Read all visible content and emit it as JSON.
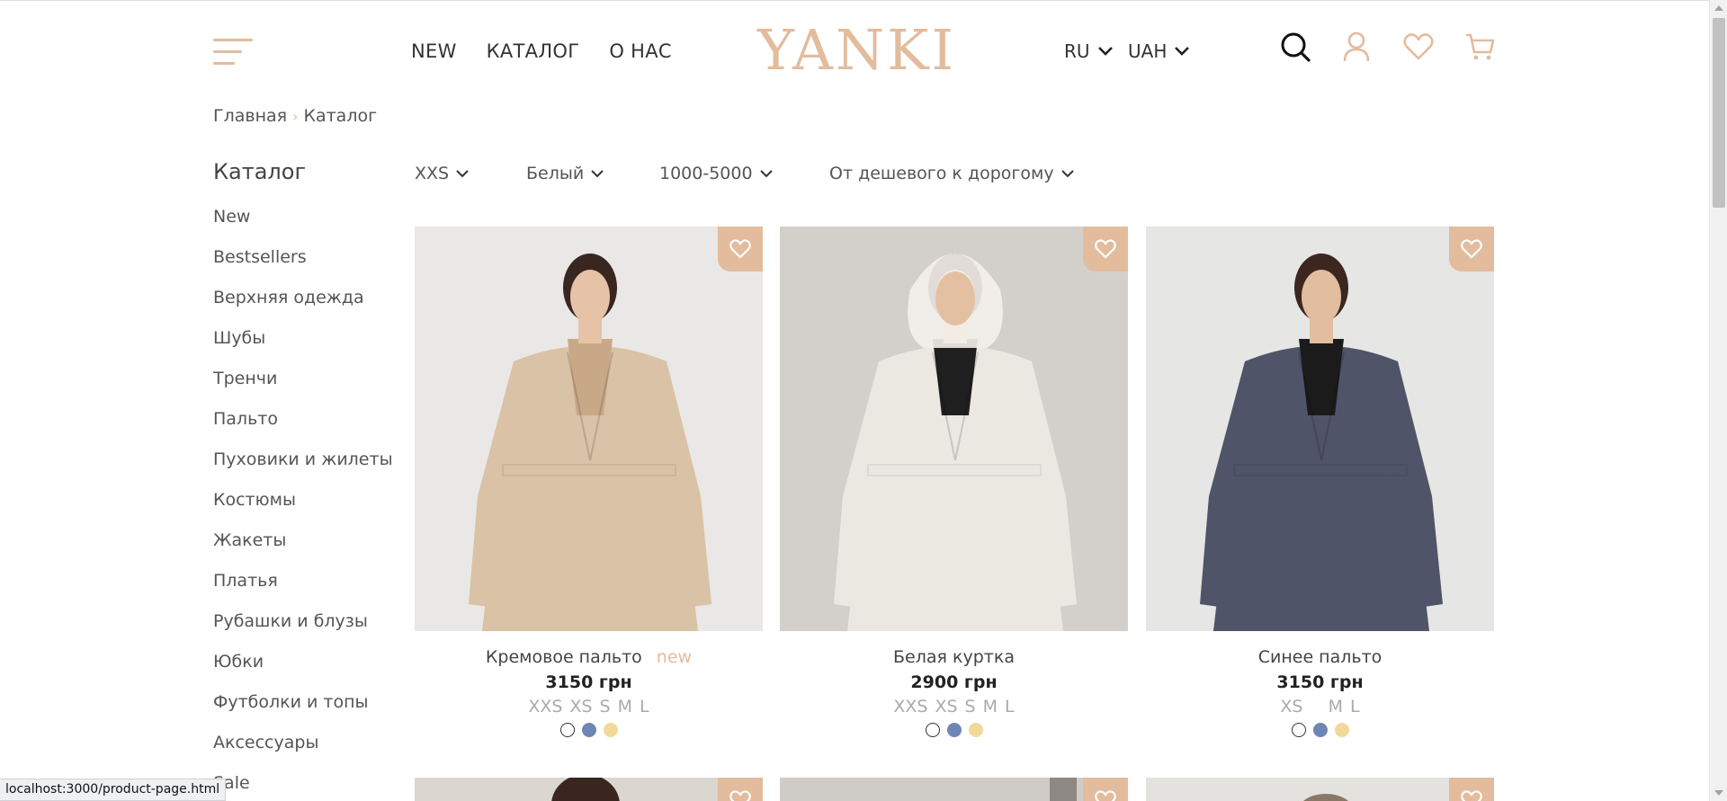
{
  "header": {
    "logo": "YANKI",
    "nav": [
      "NEW",
      "КАТАЛОГ",
      "О НАС"
    ],
    "language": "RU",
    "currency": "UAH",
    "icons": [
      "search-icon",
      "user-icon",
      "heart-icon",
      "cart-icon"
    ],
    "accent_color": "#e2bc9d"
  },
  "breadcrumb": {
    "home": "Главная",
    "separator": "›",
    "current": "Каталог"
  },
  "sidebar": {
    "title": "Каталог",
    "items": [
      "New",
      "Bestsellers",
      "Верхняя одежда",
      "Шубы",
      "Тренчи",
      "Пальто",
      "Пуховики и жилеты",
      "Костюмы",
      "Жакеты",
      "Платья",
      "Рубашки и блузы",
      "Юбки",
      "Футболки и топы",
      "Аксессуары",
      "Sale"
    ]
  },
  "filters": {
    "size": "XXS",
    "color": "Белый",
    "price": "1000-5000",
    "sort": "От дешевого к дорогому"
  },
  "products": [
    {
      "name": "Кремовое пальто",
      "tag": "new",
      "price": "3150 грн",
      "sizes": [
        "XXS",
        "XS",
        "S",
        "M",
        "L"
      ],
      "colors": [
        "#ffffff",
        "#6e86b3",
        "#f1d99a"
      ],
      "photo": {
        "bg": "#e9e8e6",
        "garment": "#d9c2a5",
        "inner": "#c9a888",
        "skin": "#e6c3a6",
        "hair": "#3a2620"
      }
    },
    {
      "name": "Белая куртка",
      "tag": "",
      "price": "2900 грн",
      "sizes": [
        "XXS",
        "XS",
        "S",
        "M",
        "L"
      ],
      "colors": [
        "#ffffff",
        "#6e86b3",
        "#f1d99a"
      ],
      "photo": {
        "bg": "#d3d0cc",
        "garment": "#ebe8e2",
        "inner": "#1f1f1f",
        "skin": "#e4c0a2",
        "hair": "#33221c"
      }
    },
    {
      "name": "Синее пальто",
      "tag": "",
      "price": "3150 грн",
      "sizes": [
        "XS",
        "",
        "M",
        "L"
      ],
      "colors": [
        "#ffffff",
        "#6e86b3",
        "#f1d99a"
      ],
      "photo": {
        "bg": "#e6e6e4",
        "garment": "#4f5468",
        "inner": "#1b1b1b",
        "skin": "#e2bd9f",
        "hair": "#3b2620"
      }
    }
  ],
  "status_url": "localhost:3000/product-page.html"
}
